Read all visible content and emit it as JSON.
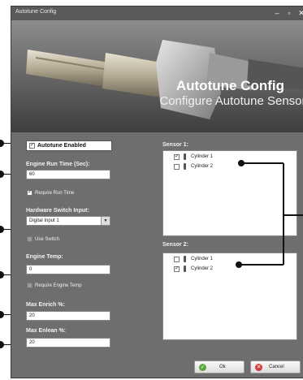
{
  "window": {
    "title": "Autotune Config",
    "min_icon": "minimize-icon",
    "max_icon": "maximize-icon",
    "close_icon": "close-icon"
  },
  "banner": {
    "title": "Autotune Config",
    "subtitle": "Configure Autotune Sensors"
  },
  "autotune_enabled": {
    "label": "Autotune Enabled",
    "checked": true
  },
  "engine_run_time": {
    "label": "Engine Run Time (Sec):",
    "value": "60",
    "require": {
      "label": "Require Run Time",
      "checked": true
    }
  },
  "hardware_switch": {
    "label": "Hardware Switch Input:",
    "value": "Digital Input 1",
    "use": {
      "label": "Use Switch",
      "checked": false
    }
  },
  "engine_temp": {
    "label": "Engine Temp:",
    "value": "0",
    "require": {
      "label": "Require Engine Temp",
      "checked": false
    }
  },
  "max_enrich": {
    "label": "Max Enrich %:",
    "value": "20"
  },
  "max_enlean": {
    "label": "Max Enlean %:",
    "value": "20"
  },
  "sensor1": {
    "label": "Sensor 1:",
    "items": [
      {
        "label": "Cylinder 1",
        "checked": true
      },
      {
        "label": "Cylinder 2",
        "checked": false
      }
    ]
  },
  "sensor2": {
    "label": "Sensor 2:",
    "items": [
      {
        "label": "Cylinder 1",
        "checked": false
      },
      {
        "label": "Cylinder 2",
        "checked": true
      }
    ]
  },
  "buttons": {
    "ok": "Ok",
    "cancel": "Cancel"
  }
}
